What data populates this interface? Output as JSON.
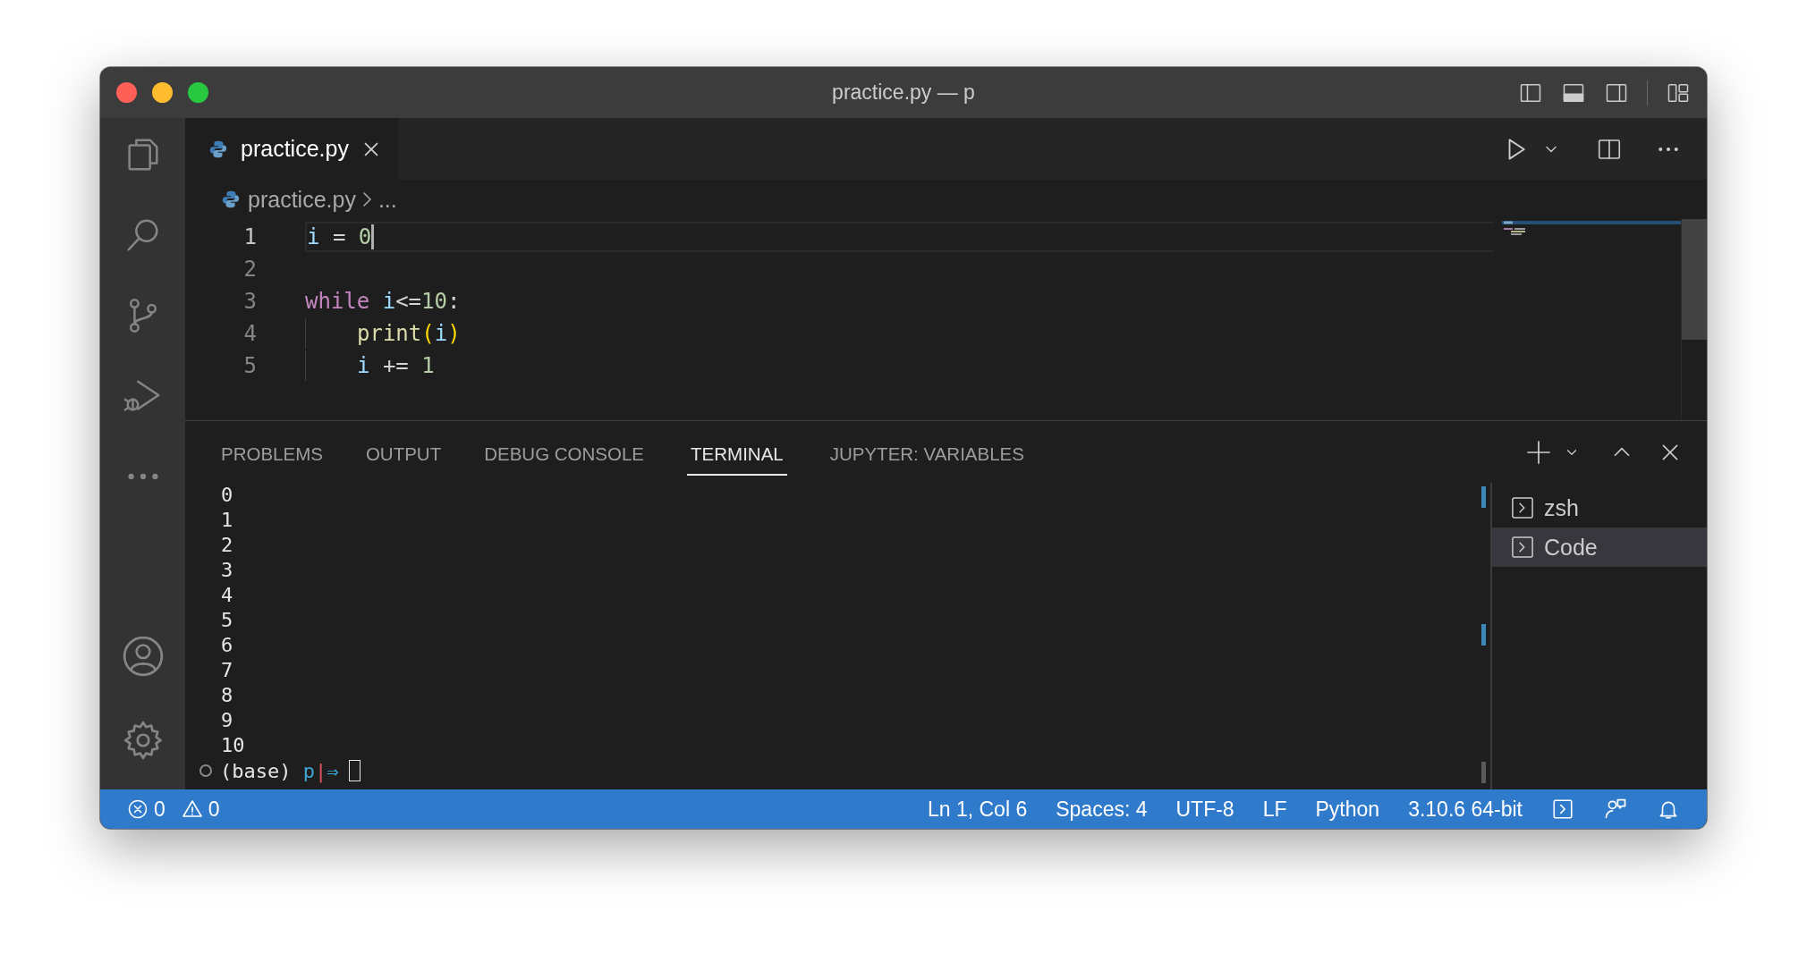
{
  "window": {
    "title": "practice.py — p"
  },
  "tabs": [
    {
      "label": "practice.py",
      "selected": true
    }
  ],
  "breadcrumb": [
    "practice.py",
    "..."
  ],
  "editor": {
    "lines": [
      {
        "number": "1",
        "current": true,
        "indent": false,
        "tokens": [
          {
            "text": "i",
            "kind": "variable"
          },
          {
            "text": " = ",
            "kind": "operator"
          },
          {
            "text": "0",
            "kind": "number"
          }
        ]
      },
      {
        "number": "2",
        "current": false,
        "indent": false
      },
      {
        "number": "3",
        "current": false,
        "indent": false,
        "tokens": [
          {
            "text": "while ",
            "kind": "keyword"
          },
          {
            "text": "i",
            "kind": "variable"
          },
          {
            "text": "<=",
            "kind": "operator"
          },
          {
            "text": "10",
            "kind": "number"
          },
          {
            "text": ":",
            "kind": "operator"
          }
        ]
      },
      {
        "number": "4",
        "current": false,
        "indent": true,
        "tokens": [
          {
            "text": "print",
            "kind": "function"
          },
          {
            "text": "(",
            "kind": "bracket"
          },
          {
            "text": "i",
            "kind": "variable"
          },
          {
            "text": ")",
            "kind": "bracket"
          }
        ]
      },
      {
        "number": "5",
        "current": false,
        "indent": true,
        "tokens": [
          {
            "text": "i",
            "kind": "variable"
          },
          {
            "text": " += ",
            "kind": "operator"
          },
          {
            "text": "1",
            "kind": "number"
          }
        ]
      }
    ]
  },
  "panel": {
    "tabs": [
      {
        "label": "PROBLEMS",
        "selected": false
      },
      {
        "label": "OUTPUT",
        "selected": false
      },
      {
        "label": "DEBUG CONSOLE",
        "selected": false
      },
      {
        "label": "TERMINAL",
        "selected": true
      },
      {
        "label": "JUPYTER: VARIABLES",
        "selected": false
      }
    ],
    "terminal": {
      "lines": [
        "0",
        "1",
        "2",
        "3",
        "4",
        "5",
        "6",
        "7",
        "8",
        "9",
        "10"
      ],
      "prompt": [
        {
          "text": "(base) ",
          "kind": "plain"
        },
        {
          "text": "p",
          "kind": "path"
        },
        {
          "text": "|",
          "kind": "separator"
        },
        {
          "text": "⇒",
          "kind": "arrow"
        }
      ]
    },
    "terminals": [
      {
        "label": "zsh",
        "selected": false
      },
      {
        "label": "Code",
        "selected": true
      }
    ]
  },
  "status_bar": {
    "errors": "0",
    "warnings": "0",
    "items": [
      "Ln 1, Col 6",
      "Spaces: 4",
      "UTF-8",
      "LF",
      "Python",
      "3.10.6 64-bit"
    ]
  }
}
